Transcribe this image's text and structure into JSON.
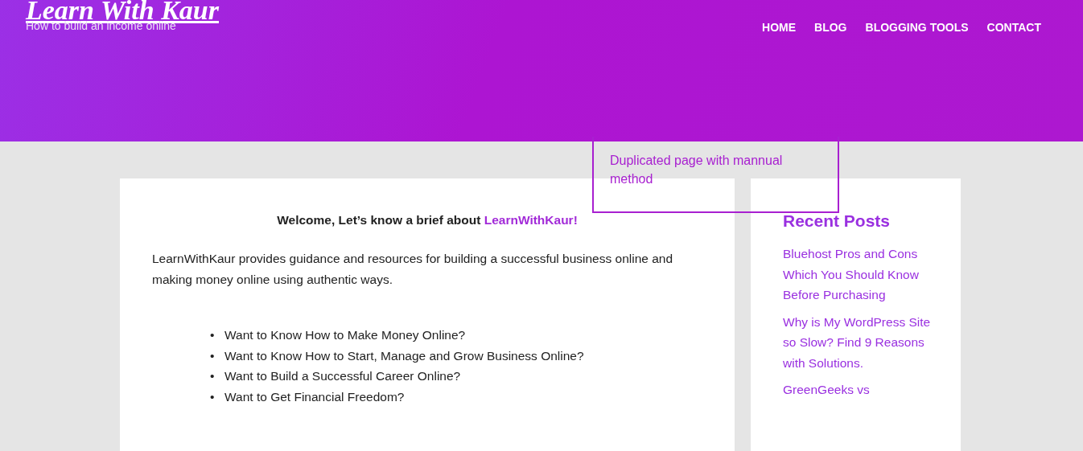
{
  "header": {
    "logo": "Learn With Kaur",
    "tagline": "How to build an income online",
    "nav": [
      {
        "label": "HOME"
      },
      {
        "label": "BLOG"
      },
      {
        "label": "BLOGGING TOOLS"
      },
      {
        "label": "CONTACT"
      }
    ]
  },
  "annotation": {
    "text": "Duplicated page with mannual method"
  },
  "article": {
    "intro": "Welcome, Let’s know a brief about ",
    "intro_link": "LearnWithKaur!",
    "paragraph": "LearnWithKaur provides guidance and resources for building a successful business online and making money online using authentic ways.",
    "bullets": [
      {
        "marker": "•",
        "text": "Want to Know How to Make Money Online?"
      },
      {
        "marker": "•",
        "text": "Want to Know How to Start, Manage and Grow Business Online?"
      },
      {
        "marker": "•",
        "text": "Want to Build a Successful Career Online?"
      },
      {
        "marker": "•",
        "text": "Want to Get Financial Freedom?"
      }
    ]
  },
  "sidebar": {
    "title": "Recent Posts",
    "posts": [
      "Bluehost Pros and Cons Which You Should Know Before Purchasing",
      "Why is My WordPress Site so Slow? Find 9 Reasons with Solutions.",
      "GreenGeeks vs"
    ]
  }
}
